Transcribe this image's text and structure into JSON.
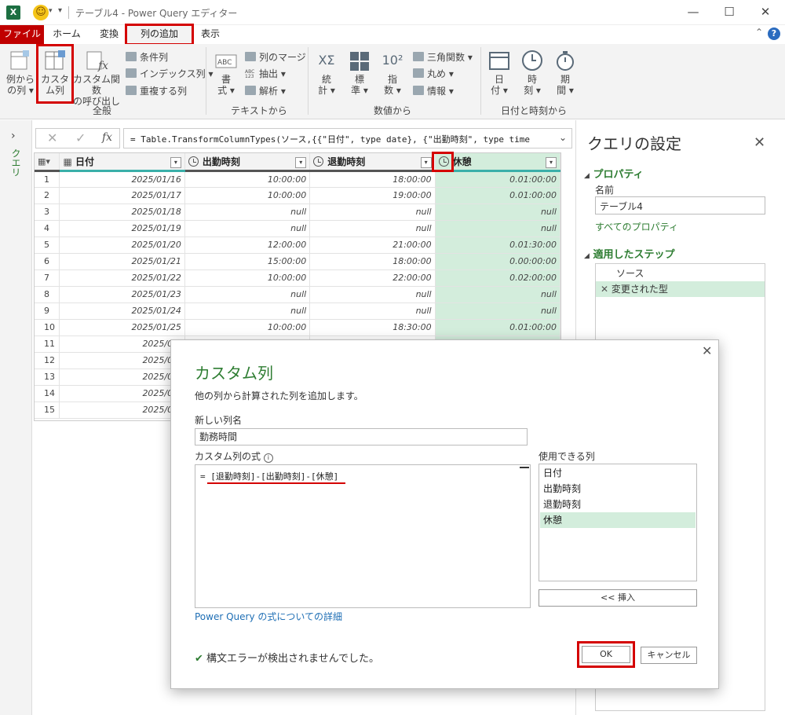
{
  "titlebar": {
    "app_badge": "X",
    "title": "テーブル4 - Power Query エディター"
  },
  "tabs": [
    "ファイル",
    "ホーム",
    "変換",
    "列の追加",
    "表示"
  ],
  "ribbon": {
    "general": {
      "col_from_examples": [
        "例から",
        "の列 ▾"
      ],
      "custom_column": [
        "カスタ",
        "ム列"
      ],
      "invoke_custom_function": [
        "カスタム関数",
        "の呼び出し"
      ],
      "conditional": "条件列",
      "index": "インデックス列",
      "duplicate": "重複する列",
      "label": "全般"
    },
    "text": {
      "format": [
        "書",
        "式 ▾"
      ],
      "merge": "列のマージ",
      "extract": "抽出 ▾",
      "parse": "解析 ▾",
      "label": "テキストから",
      "icon_abc": "ABC",
      "icon_abc123": "ABC\n123"
    },
    "number": {
      "stats": [
        "統",
        "計 ▾"
      ],
      "standard": [
        "標",
        "準 ▾"
      ],
      "scientific": [
        "指",
        "数 ▾"
      ],
      "trig": "三角関数 ▾",
      "round": "丸め ▾",
      "info": "情報 ▾",
      "label": "数値から",
      "icon_sigma": "XΣ",
      "icon_pow": "10²"
    },
    "datetime": {
      "date": [
        "日",
        "付 ▾"
      ],
      "time": [
        "時",
        "刻 ▾"
      ],
      "duration": [
        "期",
        "間 ▾"
      ],
      "label": "日付と時刻から"
    }
  },
  "left_pane": {
    "label": "クエリ"
  },
  "formula_bar": {
    "fx": "fx",
    "formula": "= Table.TransformColumnTypes(ソース,{{\"日付\", type date}, {\"出勤時刻\", type time"
  },
  "grid": {
    "columns": [
      "日付",
      "出勤時刻",
      "退勤時刻",
      "休憩"
    ],
    "rows": [
      [
        "1",
        "2025/01/16",
        "10:00:00",
        "18:00:00",
        "0.01:00:00"
      ],
      [
        "2",
        "2025/01/17",
        "10:00:00",
        "19:00:00",
        "0.01:00:00"
      ],
      [
        "3",
        "2025/01/18",
        "null",
        "null",
        "null"
      ],
      [
        "4",
        "2025/01/19",
        "null",
        "null",
        "null"
      ],
      [
        "5",
        "2025/01/20",
        "12:00:00",
        "21:00:00",
        "0.01:30:00"
      ],
      [
        "6",
        "2025/01/21",
        "15:00:00",
        "18:00:00",
        "0.00:00:00"
      ],
      [
        "7",
        "2025/01/22",
        "10:00:00",
        "22:00:00",
        "0.02:00:00"
      ],
      [
        "8",
        "2025/01/23",
        "null",
        "null",
        "null"
      ],
      [
        "9",
        "2025/01/24",
        "null",
        "null",
        "null"
      ],
      [
        "10",
        "2025/01/25",
        "10:00:00",
        "18:30:00",
        "0.01:00:00"
      ],
      [
        "11",
        "2025/01/",
        "",
        "",
        ""
      ],
      [
        "12",
        "2025/01/",
        "",
        "",
        ""
      ],
      [
        "13",
        "2025/01/",
        "",
        "",
        ""
      ],
      [
        "14",
        "2025/01/",
        "",
        "",
        ""
      ],
      [
        "15",
        "2025/01/",
        "",
        "",
        ""
      ]
    ]
  },
  "settings": {
    "title": "クエリの設定",
    "properties_header": "プロパティ",
    "name_label": "名前",
    "name_value": "テーブル4",
    "all_properties": "すべてのプロパティ",
    "steps_header": "適用したステップ",
    "steps": [
      "ソース",
      "変更された型"
    ]
  },
  "dialog": {
    "title": "カスタム列",
    "description": "他の列から計算された列を追加します。",
    "new_col_label": "新しい列名",
    "new_col_value": "勤務時間",
    "formula_label": "カスタム列の式",
    "formula_eq": "= ",
    "formula_expr": "[退勤時刻]-[出勤時刻]-[休憩]",
    "available_label": "使用できる列",
    "available": [
      "日付",
      "出勤時刻",
      "退勤時刻",
      "休憩"
    ],
    "insert": "<< 挿入",
    "learn_link": "Power Query の式についての詳細",
    "status": "構文エラーが検出されませんでした。",
    "ok": "OK",
    "cancel": "キャンセル"
  },
  "colors": {
    "file_tab": "#c00000",
    "highlight": "#d40000",
    "selected_col": "#d3eddc",
    "green": "#2e7d32"
  }
}
